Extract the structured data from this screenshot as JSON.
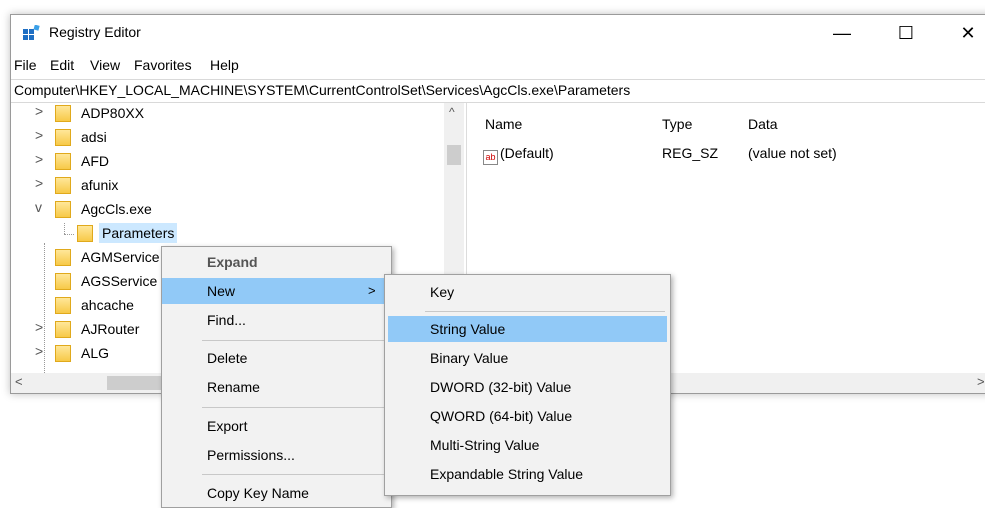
{
  "window": {
    "title": "Registry Editor",
    "minimize": "—",
    "maximize": "☐",
    "close": "✕"
  },
  "menubar": [
    "File",
    "Edit",
    "View",
    "Favorites",
    "Help"
  ],
  "address": "Computer\\HKEY_LOCAL_MACHINE\\SYSTEM\\CurrentControlSet\\Services\\AgcCls.exe\\Parameters",
  "tree": [
    {
      "label": "ADP80XX",
      "expander": ">"
    },
    {
      "label": "adsi",
      "expander": ">"
    },
    {
      "label": "AFD",
      "expander": ">"
    },
    {
      "label": "afunix",
      "expander": ">"
    },
    {
      "label": "AgcCls.exe",
      "expander": "v"
    },
    {
      "label": "Parameters",
      "expander": ""
    },
    {
      "label": "AGMService",
      "expander": ""
    },
    {
      "label": "AGSService",
      "expander": ""
    },
    {
      "label": "ahcache",
      "expander": ""
    },
    {
      "label": "AJRouter",
      "expander": ">"
    },
    {
      "label": "ALG",
      "expander": ">"
    }
  ],
  "list": {
    "headers": [
      "Name",
      "Type",
      "Data"
    ],
    "rows": [
      {
        "icon": "ab",
        "name": "(Default)",
        "type": "REG_SZ",
        "data": "(value not set)"
      }
    ]
  },
  "context_menu": {
    "items": [
      "Expand",
      "New",
      "Find...",
      "Delete",
      "Rename",
      "Export",
      "Permissions...",
      "Copy Key Name"
    ],
    "submenu_arrow": ">"
  },
  "submenu": {
    "items": [
      "Key",
      "String Value",
      "Binary Value",
      "DWORD (32-bit) Value",
      "QWORD (64-bit) Value",
      "Multi-String Value",
      "Expandable String Value"
    ]
  },
  "scroll": {
    "up": "^",
    "left": "<",
    "right": ">"
  },
  "colors": {
    "highlight": "#91c9f7",
    "folder": "#f7c948"
  }
}
